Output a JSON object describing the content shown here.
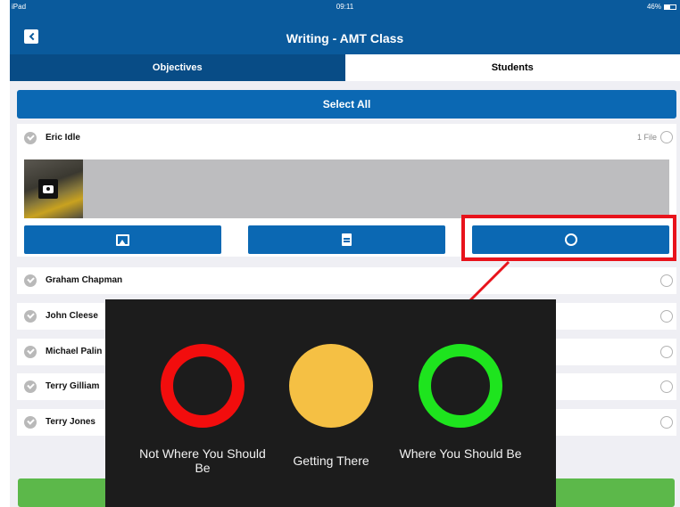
{
  "status_bar": {
    "device": "iPad",
    "time": "09:11",
    "battery": "46%"
  },
  "nav": {
    "title": "Writing - AMT Class"
  },
  "tabs": [
    {
      "label": "Objectives"
    },
    {
      "label": "Students"
    }
  ],
  "select_all_label": "Select All",
  "expanded_student": {
    "name": "Eric Idle",
    "file_count": "1 File"
  },
  "students": [
    {
      "name": "Graham Chapman"
    },
    {
      "name": "John Cleese"
    },
    {
      "name": "Michael Palin"
    },
    {
      "name": "Terry Gilliam"
    },
    {
      "name": "Terry Jones"
    }
  ],
  "popup": {
    "choices": [
      {
        "label": "Not Where You Should Be",
        "color": "#f20d0d"
      },
      {
        "label": "Getting There",
        "color": "#f5c044"
      },
      {
        "label": "Where You Should Be",
        "color": "#1ee41e"
      }
    ]
  },
  "colors": {
    "primary": "#0b68b3",
    "nav": "#0a5a9c",
    "highlight": "#e8131b",
    "success": "#5cb84a"
  },
  "icons": [
    "back-chevron-icon",
    "check-icon",
    "radio-icon",
    "camera-icon",
    "image-icon",
    "note-icon",
    "ring-icon"
  ]
}
